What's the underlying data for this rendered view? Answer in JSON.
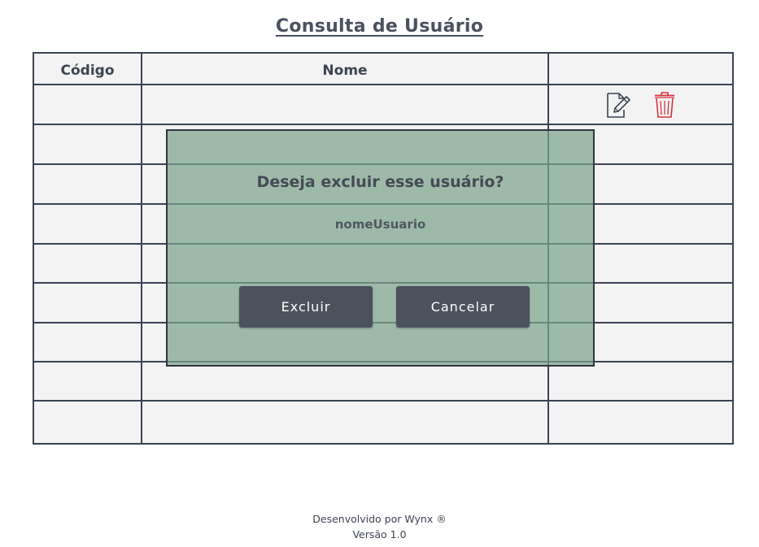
{
  "page": {
    "title": "Consulta de Usuário"
  },
  "table": {
    "headers": {
      "codigo": "Código",
      "nome": "Nome",
      "acoes": ""
    },
    "rows": [
      {
        "codigo": "",
        "nome": "",
        "has_actions": true
      },
      {
        "codigo": "",
        "nome": "",
        "has_actions": false
      },
      {
        "codigo": "",
        "nome": "",
        "has_actions": false
      },
      {
        "codigo": "",
        "nome": "",
        "has_actions": false
      },
      {
        "codigo": "",
        "nome": "",
        "has_actions": false
      },
      {
        "codigo": "",
        "nome": "",
        "has_actions": false
      },
      {
        "codigo": "",
        "nome": "",
        "has_actions": false
      },
      {
        "codigo": "",
        "nome": "",
        "has_actions": false
      },
      {
        "codigo": "",
        "nome": "",
        "has_actions": false
      }
    ],
    "action_icons": {
      "edit": "edit-icon",
      "delete": "trash-icon"
    }
  },
  "modal": {
    "question": "Deseja excluir esse usuário?",
    "username": "nomeUsuario",
    "confirm_label": "Excluir",
    "cancel_label": "Cancelar"
  },
  "footer": {
    "line1": "Desenvolvido por Wynx ®",
    "line2": "Versão 1.0"
  },
  "colors": {
    "table_border": "#3a4354",
    "table_bg": "#f3f3f3",
    "modal_bg": "#7ca28a",
    "button_bg": "#4b525e",
    "delete_icon": "#d8323c",
    "edit_icon": "#3a4354"
  }
}
